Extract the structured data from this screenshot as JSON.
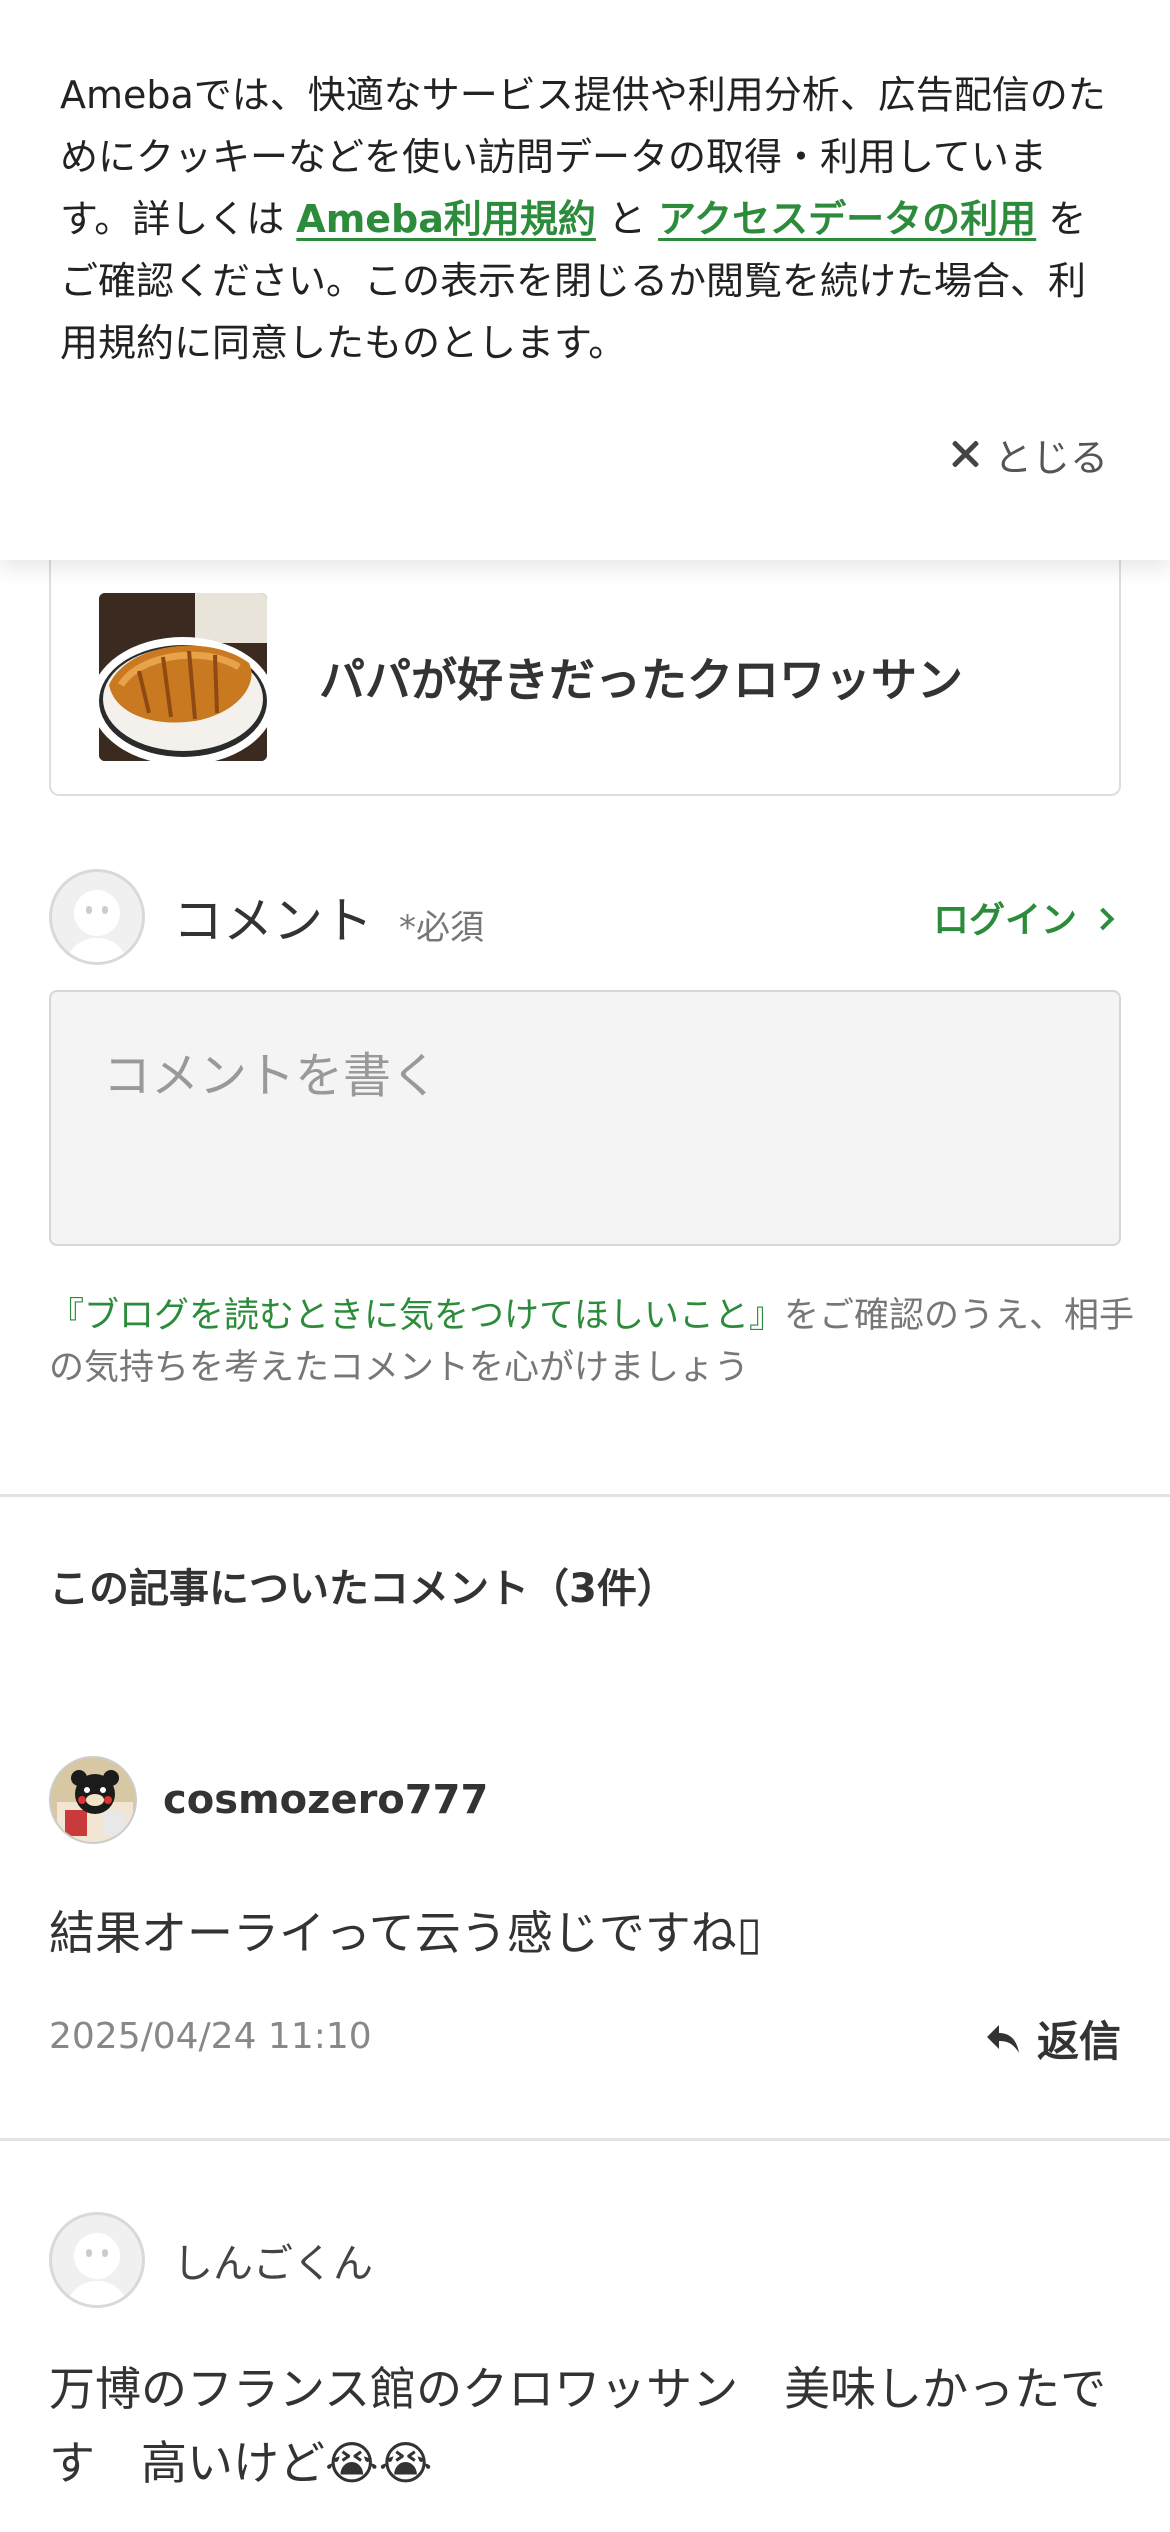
{
  "cookie_banner": {
    "text_intro": "Amebaでは、快適なサービス提供や利用分析、広告配信のためにクッキーなどを使い訪問データの取得・利用しています。詳しくは ",
    "link_terms": "Ameba利用規約",
    "text_and": " と ",
    "link_access_data": "アクセスデータの利用",
    "text_outro": " をご確認ください。この表示を閉じるか閲覧を続けた場合、利用規約に同意したものとします。",
    "close_label": "とじる"
  },
  "article": {
    "title": "パパが好きだったクロワッサン"
  },
  "comment_form": {
    "label": "コメント",
    "required": "*必須",
    "login_label": "ログイン",
    "placeholder": "コメントを書く",
    "guide_link": "『ブログを読むときに気をつけてほしいこと』",
    "guide_text": "をご確認のうえ、相手の気持ちを考えたコメントを心がけましょう"
  },
  "comments_section": {
    "title": "この記事についたコメント（3件）",
    "comments": [
      {
        "author": "cosmozero777",
        "text": "結果オーライって云う感じですね▯",
        "date": "2025/04/24 11:10",
        "reply_label": "返信"
      },
      {
        "author": "しんごくん",
        "text": "万博のフランス館のクロワッサン　美味しかったです　高いけど😭😭"
      }
    ]
  },
  "icons": [
    "close-icon",
    "chevron-right-icon",
    "default-avatar-icon",
    "reply-arrow-icon"
  ],
  "colors": {
    "accent_green": "#2d8c3c",
    "text": "#333333",
    "muted": "#888888",
    "divider": "#e3e3e3"
  }
}
